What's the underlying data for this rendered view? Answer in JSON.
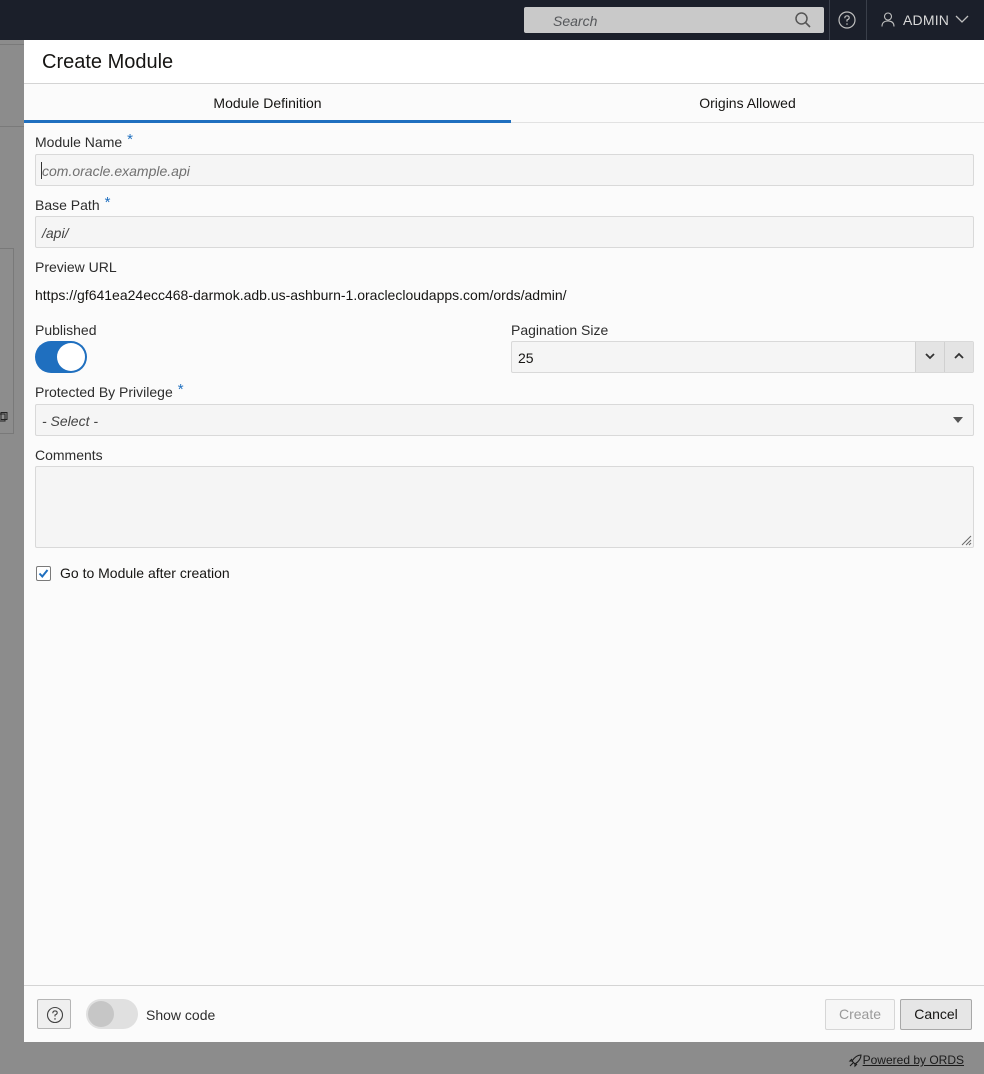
{
  "topbar": {
    "search_placeholder": "Search",
    "user": "ADMIN"
  },
  "dialog": {
    "title": "Create Module",
    "tabs": [
      {
        "label": "Module Definition",
        "active": true
      },
      {
        "label": "Origins Allowed",
        "active": false
      }
    ],
    "fields": {
      "module_name": {
        "label": "Module Name",
        "required_mark": "*",
        "placeholder": "com.oracle.example.api"
      },
      "base_path": {
        "label": "Base Path",
        "required_mark": "*",
        "value": "/api/"
      },
      "preview_url": {
        "label": "Preview URL",
        "value": "https://gf641ea24ecc468-darmok.adb.us-ashburn-1.oraclecloudapps.com/ords/admin/"
      },
      "published": {
        "label": "Published",
        "on": true
      },
      "pagination_size": {
        "label": "Pagination Size",
        "value": "25"
      },
      "protected_by_privilege": {
        "label": "Protected By Privilege",
        "required_mark": "*",
        "selected": "- Select -"
      },
      "comments": {
        "label": "Comments",
        "value": ""
      },
      "go_to_module": {
        "label": "Go to Module after creation",
        "checked": true
      }
    },
    "footer": {
      "show_code_label": "Show code",
      "show_code_on": false,
      "create_label": "Create",
      "cancel_label": "Cancel"
    }
  },
  "page_footer": {
    "powered_by": "Powered by ORDS"
  },
  "colors": {
    "accent": "#1f6fbf",
    "topbar": "#1b1f2a"
  }
}
